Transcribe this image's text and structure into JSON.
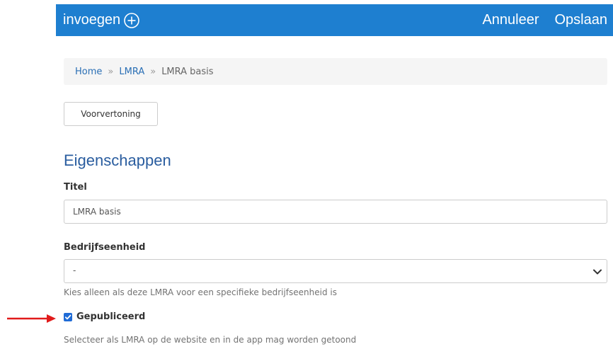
{
  "colors": {
    "brand": "#1e7fd0",
    "link": "#2a6fb5",
    "section_title": "#2a5d9f",
    "annotation_arrow": "#e11b1b",
    "checkbox": "#1f6bd6"
  },
  "topbar": {
    "insert_label": "invoegen",
    "insert_icon": "plus-circle-icon",
    "cancel_label": "Annuleer",
    "save_label": "Opslaan"
  },
  "breadcrumb": {
    "items": [
      "Home",
      "LMRA",
      "LMRA basis"
    ],
    "separator": "»"
  },
  "toolbar": {
    "preview_label": "Voorvertoning"
  },
  "form": {
    "section_title": "Eigenschappen",
    "title_label": "Titel",
    "title_value": "LMRA basis",
    "unit_label": "Bedrijfseenheid",
    "unit_selected": "-",
    "unit_help": "Kies alleen als deze LMRA voor een specifieke bedrijfseenheid is",
    "published_label": "Gepubliceerd",
    "published_checked": true,
    "published_help": "Selecteer als LMRA op de website en in de app mag worden getoond"
  }
}
